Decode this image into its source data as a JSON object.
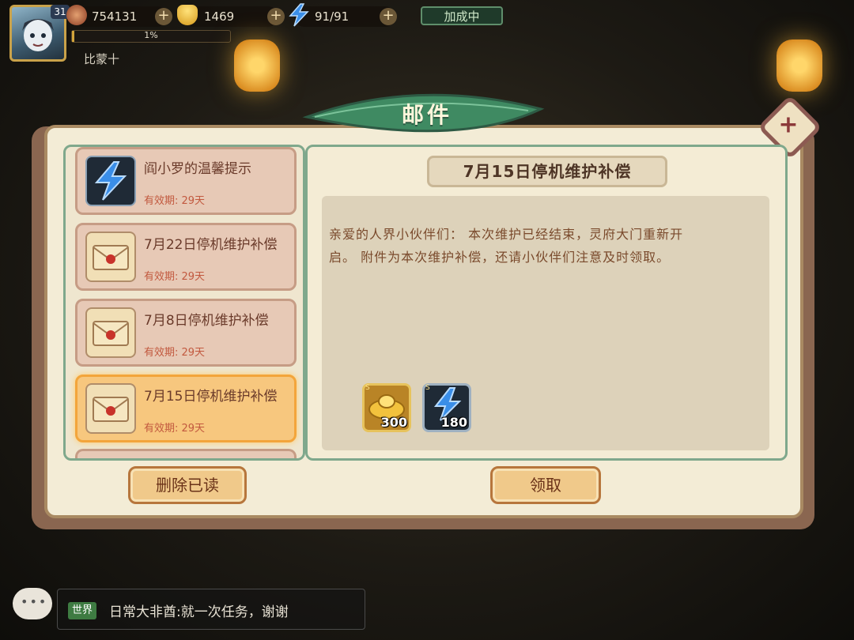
{
  "hud": {
    "level": "31",
    "coins": "754131",
    "gold_ingots": "1469",
    "energy": "91/91",
    "bonus_status": "加成中",
    "exp_percent": "1%",
    "exp_fraction": 0.01,
    "player_name": "比蒙十"
  },
  "mail": {
    "title": "邮件",
    "items": [
      {
        "title": "阎小罗的温馨提示",
        "expiry": "有效期: 29天",
        "icon": "lightning-icon"
      },
      {
        "title": "7月22日停机维护补偿",
        "expiry": "有效期: 29天",
        "icon": "envelope-icon"
      },
      {
        "title": "7月8日停机维护补偿",
        "expiry": "有效期: 29天",
        "icon": "envelope-icon"
      },
      {
        "title": "7月15日停机维护补偿",
        "expiry": "有效期: 29天",
        "icon": "envelope-icon",
        "selected": true
      }
    ],
    "selected": {
      "title": "7月15日停机维护补偿",
      "body_line1": "亲爱的人界小伙伴们： 本次维护已经结束，灵府大门重新开",
      "body_line2": "启。 附件为本次维护补偿，还请小伙伴们注意及时领取。",
      "attachments": [
        {
          "icon": "gold-ingot-icon",
          "count": "300"
        },
        {
          "icon": "lightning-icon",
          "count": "180"
        }
      ]
    },
    "delete_read_label": "删除已读",
    "claim_label": "领取"
  },
  "chat": {
    "channel": "世界",
    "message": "日常大非酋:就一次任务，谢谢"
  },
  "colors": {
    "panel_bg": "#f3ecd6",
    "frame_green": "#7fa88c",
    "selected_item": "#f7c77e",
    "button": "#f0c98a"
  }
}
